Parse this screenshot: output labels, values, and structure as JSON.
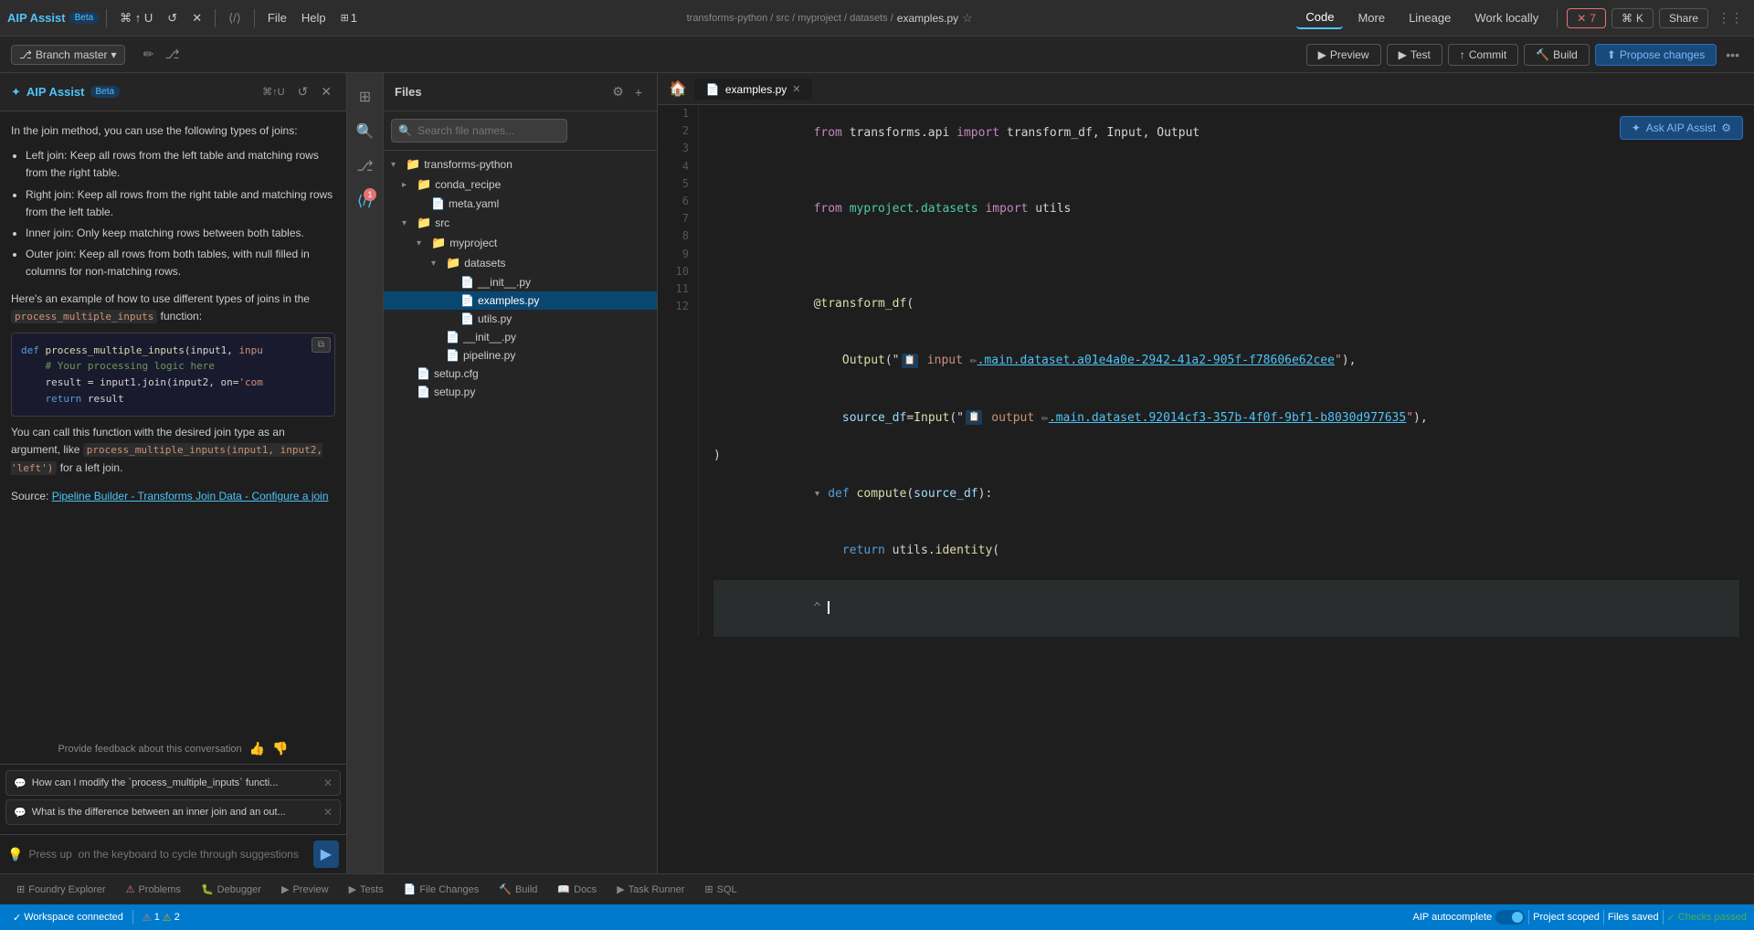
{
  "topNav": {
    "title": "AIP Assist",
    "beta": "Beta",
    "shortcut": "⌘ ↑ U",
    "fileMenu": "File",
    "helpMenu": "Help",
    "workspaceCount": "1",
    "tabs": [
      {
        "id": "code",
        "label": "Code",
        "active": true
      },
      {
        "id": "more",
        "label": "More"
      },
      {
        "id": "lineage",
        "label": "Lineage"
      },
      {
        "id": "workLocally",
        "label": "Work locally"
      },
      {
        "id": "share",
        "label": "Share"
      }
    ],
    "errCount": "7",
    "kShortcut": "K"
  },
  "secondNav": {
    "branch": "master",
    "previewBtn": "Preview",
    "testBtn": "Test",
    "commitBtn": "Commit",
    "buildBtn": "Build",
    "proposeBtn": "Propose changes"
  },
  "filePanel": {
    "title": "Files",
    "searchPlaceholder": "Search file names...",
    "tree": [
      {
        "id": "transforms-python",
        "label": "transforms-python",
        "type": "folder",
        "level": 0,
        "open": true
      },
      {
        "id": "conda_recipe",
        "label": "conda_recipe",
        "type": "folder",
        "level": 1,
        "open": false
      },
      {
        "id": "meta.yaml",
        "label": "meta.yaml",
        "type": "file-yaml",
        "level": 2
      },
      {
        "id": "src",
        "label": "src",
        "type": "folder",
        "level": 1,
        "open": true
      },
      {
        "id": "myproject",
        "label": "myproject",
        "type": "folder",
        "level": 2,
        "open": true
      },
      {
        "id": "datasets",
        "label": "datasets",
        "type": "folder",
        "level": 3,
        "open": true
      },
      {
        "id": "init1",
        "label": "__init__.py",
        "type": "file-py",
        "level": 4
      },
      {
        "id": "examples",
        "label": "examples.py",
        "type": "file-py",
        "level": 4,
        "selected": true
      },
      {
        "id": "utils",
        "label": "utils.py",
        "type": "file-py",
        "level": 4
      },
      {
        "id": "init2",
        "label": "__init__.py",
        "type": "file-py",
        "level": 3
      },
      {
        "id": "pipeline",
        "label": "pipeline.py",
        "type": "file-py",
        "level": 3
      },
      {
        "id": "setup.cfg",
        "label": "setup.cfg",
        "type": "file",
        "level": 1
      },
      {
        "id": "setup.py",
        "label": "setup.py",
        "type": "file-py",
        "level": 1
      }
    ]
  },
  "editor": {
    "filename": "examples.py",
    "lines": [
      {
        "num": 1,
        "content": "from transforms.api import transform_df, Input, Output"
      },
      {
        "num": 2,
        "content": ""
      },
      {
        "num": 3,
        "content": "from myproject.datasets import utils"
      },
      {
        "num": 4,
        "content": ""
      },
      {
        "num": 5,
        "content": ""
      },
      {
        "num": 6,
        "content": "@transform_df("
      },
      {
        "num": 7,
        "content": "    Output(\"  input  .main.dataset.a01e4a0e-2942-41a2-905f-f78606e62cee\"),"
      },
      {
        "num": 8,
        "content": "    source_df=Input(\"  output  .main.dataset.92014cf3-357b-4f0f-9bf1-b8030d977635\"),"
      },
      {
        "num": 9,
        "content": ")"
      },
      {
        "num": 10,
        "content": "def compute(source_df):"
      },
      {
        "num": 11,
        "content": "    return utils.identity("
      },
      {
        "num": 12,
        "content": "^"
      }
    ],
    "askBtn": "Ask AIP Assist"
  },
  "aipPanel": {
    "title": "AIP Assist",
    "beta": "Beta",
    "content": {
      "intro": "In the join method, you can use the following types of joins:",
      "joinTypes": [
        "Left join: Keep all rows from the left table and matching rows from the right table.",
        "Right join: Keep all rows from the right table and matching rows from the left table.",
        "Inner join: Only keep matching rows between both tables.",
        "Outer join: Keep all rows from both tables, with null filled in columns for non-matching rows."
      ],
      "exampleIntro": "Here's an example of how to use different types of joins in the",
      "funcName": "process_multiple_inputs",
      "funcSuffix": "function:",
      "codeLines": [
        "def process_multiple_inputs(input1, inpu",
        "    # Your processing logic here",
        "    result = input1.join(input2, on='com",
        "    return result"
      ],
      "afterCode": "You can call this function with the desired join type as an argument, like",
      "callExample": "process_multiple_inputs(input1, input2, 'left')",
      "callSuffix": "for a left join.",
      "sourceLabel": "Source:",
      "sourceLink": "Pipeline Builder - Transforms Join Data - Configure a join",
      "feedbackText": "Provide feedback about this conversation"
    },
    "suggestions": [
      "How can I modify the `process_multiple_inputs` functi...",
      "What is the difference between an inner join and an out..."
    ],
    "inputPlaceholder": "Press up  on the keyboard to cycle through suggestions"
  },
  "bottomPanel": {
    "tabs": [
      {
        "id": "foundry",
        "label": "Foundry Explorer"
      },
      {
        "id": "problems",
        "label": "Problems",
        "errors": 1,
        "warnings": 2
      },
      {
        "id": "debugger",
        "label": "Debugger"
      },
      {
        "id": "preview",
        "label": "Preview"
      },
      {
        "id": "tests",
        "label": "Tests"
      },
      {
        "id": "filechanges",
        "label": "File Changes"
      },
      {
        "id": "build",
        "label": "Build"
      },
      {
        "id": "docs",
        "label": "Docs"
      },
      {
        "id": "taskrunner",
        "label": "Task Runner"
      },
      {
        "id": "sql",
        "label": "SQL"
      }
    ]
  },
  "statusBar": {
    "connected": "Workspace connected",
    "errors": "1",
    "warnings": "2",
    "autocomplete": "AIP autocomplete",
    "projectScoped": "Project scoped",
    "filesSaved": "Files saved",
    "checks": "Checks passed"
  }
}
